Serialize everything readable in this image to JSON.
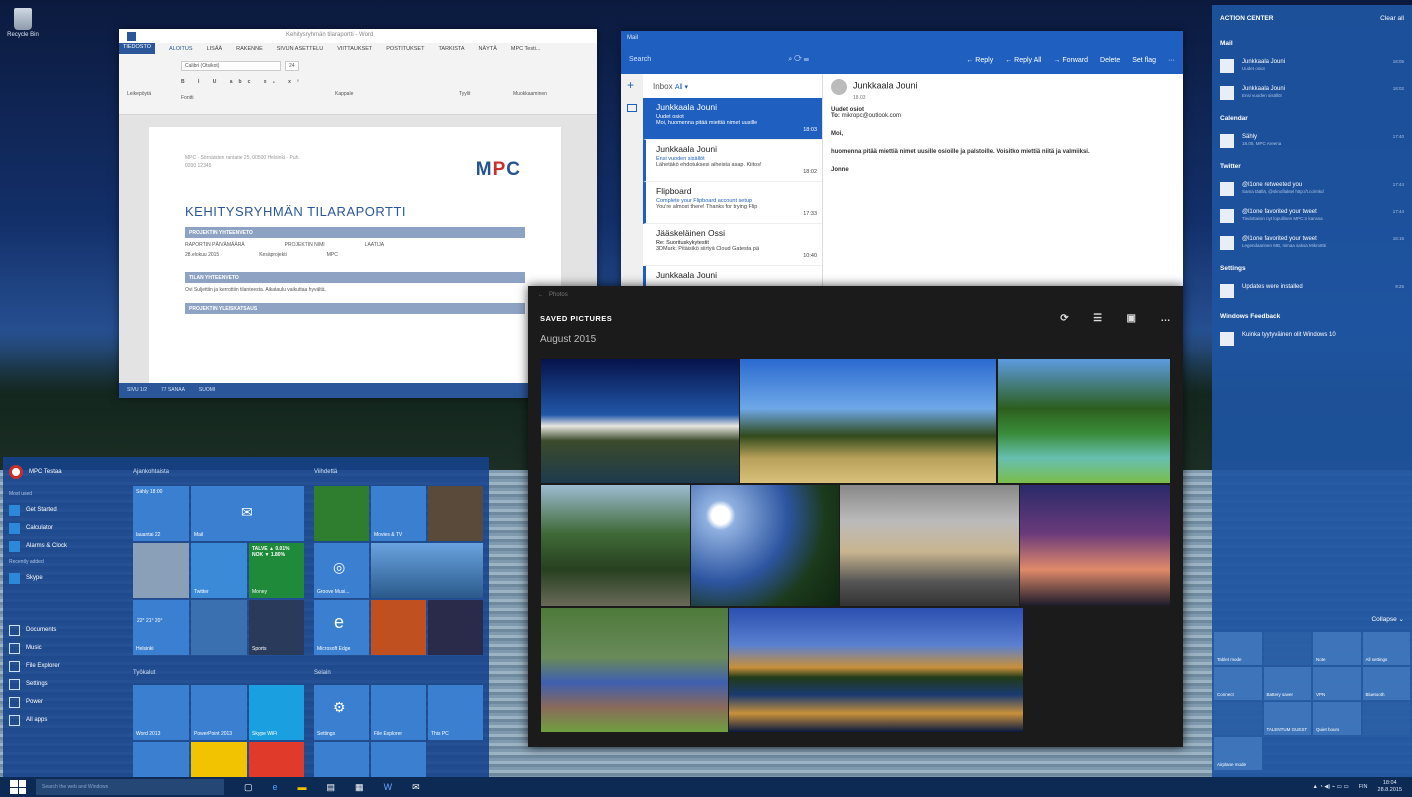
{
  "desktop": {
    "recycle_bin": "Recycle Bin"
  },
  "word": {
    "quick_access": [
      "Kehitysryhmän tilaraportti - Word"
    ],
    "tabs": [
      "TIEDOSTO",
      "ALOITUS",
      "LISÄÄ",
      "RAKENNE",
      "SIVUN ASETTELU",
      "VIITTAUKSET",
      "POSTITUKSET",
      "TARKISTA",
      "NÄYTÄ"
    ],
    "user": "MPC Testi...",
    "font": "Calibri (Otsikot)",
    "size": "24",
    "ribbon_groups": [
      "Leikepöytä",
      "Fontti",
      "Kappale",
      "Tyylit",
      "Muokkaaminen"
    ],
    "doc": {
      "logo_a": "M",
      "logo_b": "P",
      "logo_c": "C",
      "address": "MPC · Sörnäisten rantatie 25, 00500 Helsinki · Puh. 0200 12345",
      "title": "KEHITYSRYHMÄN TILARAPORTTI",
      "band1": "PROJEKTIN YHTEENVETO",
      "cols": [
        "RAPORTIN PÄIVÄMÄÄRÄ",
        "PROJEKTIN NIMI",
        "LAATIJA"
      ],
      "vals": [
        "28.elokuu 2015",
        "Kesäprojekti",
        "MPC"
      ],
      "band2": "TILAN YHTEENVETO",
      "para": "Ovi Suljettiin ja kerrottiin tilanteesta. Aikataulu vaikuttaa hyvältä.",
      "band3": "PROJEKTIN YLEISKATSAUS"
    },
    "status": [
      "SIVU 1/2",
      "77 SANAA",
      "SUOMI"
    ]
  },
  "mail": {
    "app": "Mail",
    "search": "Search",
    "actions": [
      "← Reply",
      "← Reply All",
      "→ Forward",
      "Delete",
      "Set flag"
    ],
    "inbox": "Inbox",
    "filter": "All ▾",
    "messages": [
      {
        "name": "Junkkaala Jouni",
        "subject": "Uudet osiot",
        "preview": "Moi, huomenna pitää miettiä nimet uusille",
        "time": "18:03"
      },
      {
        "name": "Junkkaala Jouni",
        "subject": "Ensi vuoden sisällöt",
        "preview": "Lähetäkö ehdotuksesi aiheista asap. Kiitos!",
        "time": "18:02"
      },
      {
        "name": "Flipboard",
        "subject": "Complete your Flipboard account setup",
        "preview": "You're almost there! Thanks for trying Flip",
        "time": "17:33"
      },
      {
        "name": "Jääskeläinen Ossi",
        "subject": "Re: Suorituskykytestit",
        "preview": "3DMark: Pitäisikö siirtyä Cloud Gatesta pä",
        "time": "10:40"
      },
      {
        "name": "Junkkaala Jouni",
        "subject": "",
        "preview": "",
        "time": ""
      }
    ],
    "read": {
      "sender": "Junkkaala Jouni",
      "time": "18.03",
      "subject": "Uudet osiot",
      "to_label": "To:",
      "to": "mikropc@outlook.com",
      "greeting": "Moi,",
      "body": "huomenna pitää miettiä nimet uusille osioille ja palstoille. Voisitko miettiä niitä ja valmiiksi.",
      "sign": "Jonne"
    }
  },
  "photos": {
    "app": "Photos",
    "header": "SAVED PICTURES",
    "month": "August 2015"
  },
  "start": {
    "user": "MPC Testaa",
    "most_used": "Most used",
    "items": [
      "Get Started",
      "Calculator",
      "Alarms & Clock"
    ],
    "recent": "Recently added",
    "recent_items": [
      "Skype"
    ],
    "bottom": [
      "Documents",
      "Music",
      "File Explorer",
      "Settings",
      "Power",
      "All apps"
    ],
    "groups": [
      "Ajankohtaista",
      "Viihdettä",
      "Työkalut",
      "Selain"
    ],
    "tiles": {
      "calendar": "Sähly\n18:00",
      "cal_day": "lauantai 22",
      "mail": "Mail",
      "twitter": "Twitter",
      "money": "Money",
      "money_txt": "TALVE ▲ 0.01% NOK ▼ 1.80%",
      "weather": "Helsinki",
      "weather_t": "22° 21° 20°",
      "sports": "Sports",
      "edge": "Microsoft Edge",
      "groove": "Groove Musi...",
      "movies": "Movies & TV",
      "xbox": "Xbox",
      "word": "Word 2013",
      "ppt": "PowerPoint 2013",
      "skype": "Skype WiFi",
      "settings": "Settings",
      "explorer": "File Explorer",
      "thispc": "This PC"
    }
  },
  "action_center": {
    "title": "ACTION CENTER",
    "clear": "Clear all",
    "sections": [
      {
        "name": "Mail",
        "items": [
          {
            "t1": "Junkkaala Jouni",
            "t2": "Uudet osiot",
            "tm": "18:05"
          },
          {
            "t1": "Junkkaala Jouni",
            "t2": "Ensi vuoden sisällöt",
            "tm": "18:02"
          }
        ]
      },
      {
        "name": "Calendar",
        "items": [
          {
            "t1": "Sähly",
            "t2": "18.00, MPC Areena",
            "tm": "17:40"
          }
        ]
      },
      {
        "name": "Twitter",
        "items": [
          {
            "t1": "@l1one retweeted you",
            "t2": "Sama täällä, @sknoflaktel http://t.co/mkd",
            "tm": "17:44"
          },
          {
            "t1": "@l1one favorited your tweet",
            "t2": "Tiedottaisin nyt lopullisen MPC:n kanssa",
            "tm": "17:44"
          },
          {
            "t1": "@l1one favorited your tweet",
            "t2": "Legendaarinen MB, nimaa saksa Mikro8tti",
            "tm": "16:16"
          }
        ]
      },
      {
        "name": "Settings",
        "items": [
          {
            "t1": "Updates were installed",
            "t2": "",
            "tm": "9:25"
          }
        ]
      },
      {
        "name": "Windows Feedback",
        "items": [
          {
            "t1": "Kuinka tyytyväinen olit Windows 10",
            "t2": "",
            "tm": ""
          }
        ]
      }
    ],
    "collapse": "Collapse",
    "quick": [
      "Tablet mode",
      "",
      "Note",
      "All settings",
      "Connect",
      "Battery saver",
      "VPN",
      "Bluetooth",
      "",
      "TALENTUM GUEST",
      "Quiet hours",
      "",
      "Airplane mode"
    ]
  },
  "taskbar": {
    "search": "Search the web and Windows",
    "lang": "FIN",
    "time": "18:04",
    "date": "28.8.2015"
  }
}
